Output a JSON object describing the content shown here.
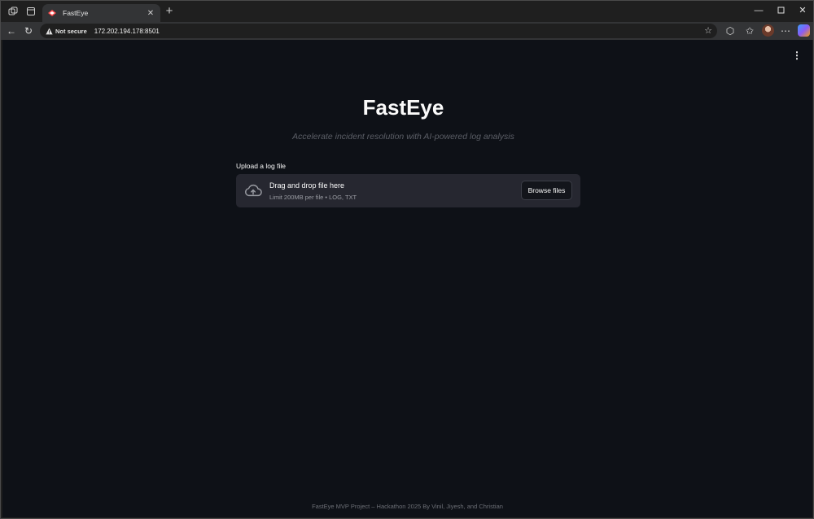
{
  "browser": {
    "tab": {
      "title": "FastEye"
    },
    "address": {
      "security_label": "Not secure",
      "url": "172.202.194.178:8501"
    }
  },
  "app": {
    "title": "FastEye",
    "subtitle": "Accelerate incident resolution with AI-powered log analysis",
    "uploader": {
      "label": "Upload a log file",
      "drop_text": "Drag and drop file here",
      "limit_text": "Limit 200MB per file • LOG, TXT",
      "browse_label": "Browse files"
    },
    "footer": "FastEye MVP Project – Hackathon 2025 By Vinil, Jiyesh, and Christian"
  },
  "colors": {
    "background": "#0e1117",
    "dropzone": "#262730",
    "text": "#fafafa"
  }
}
